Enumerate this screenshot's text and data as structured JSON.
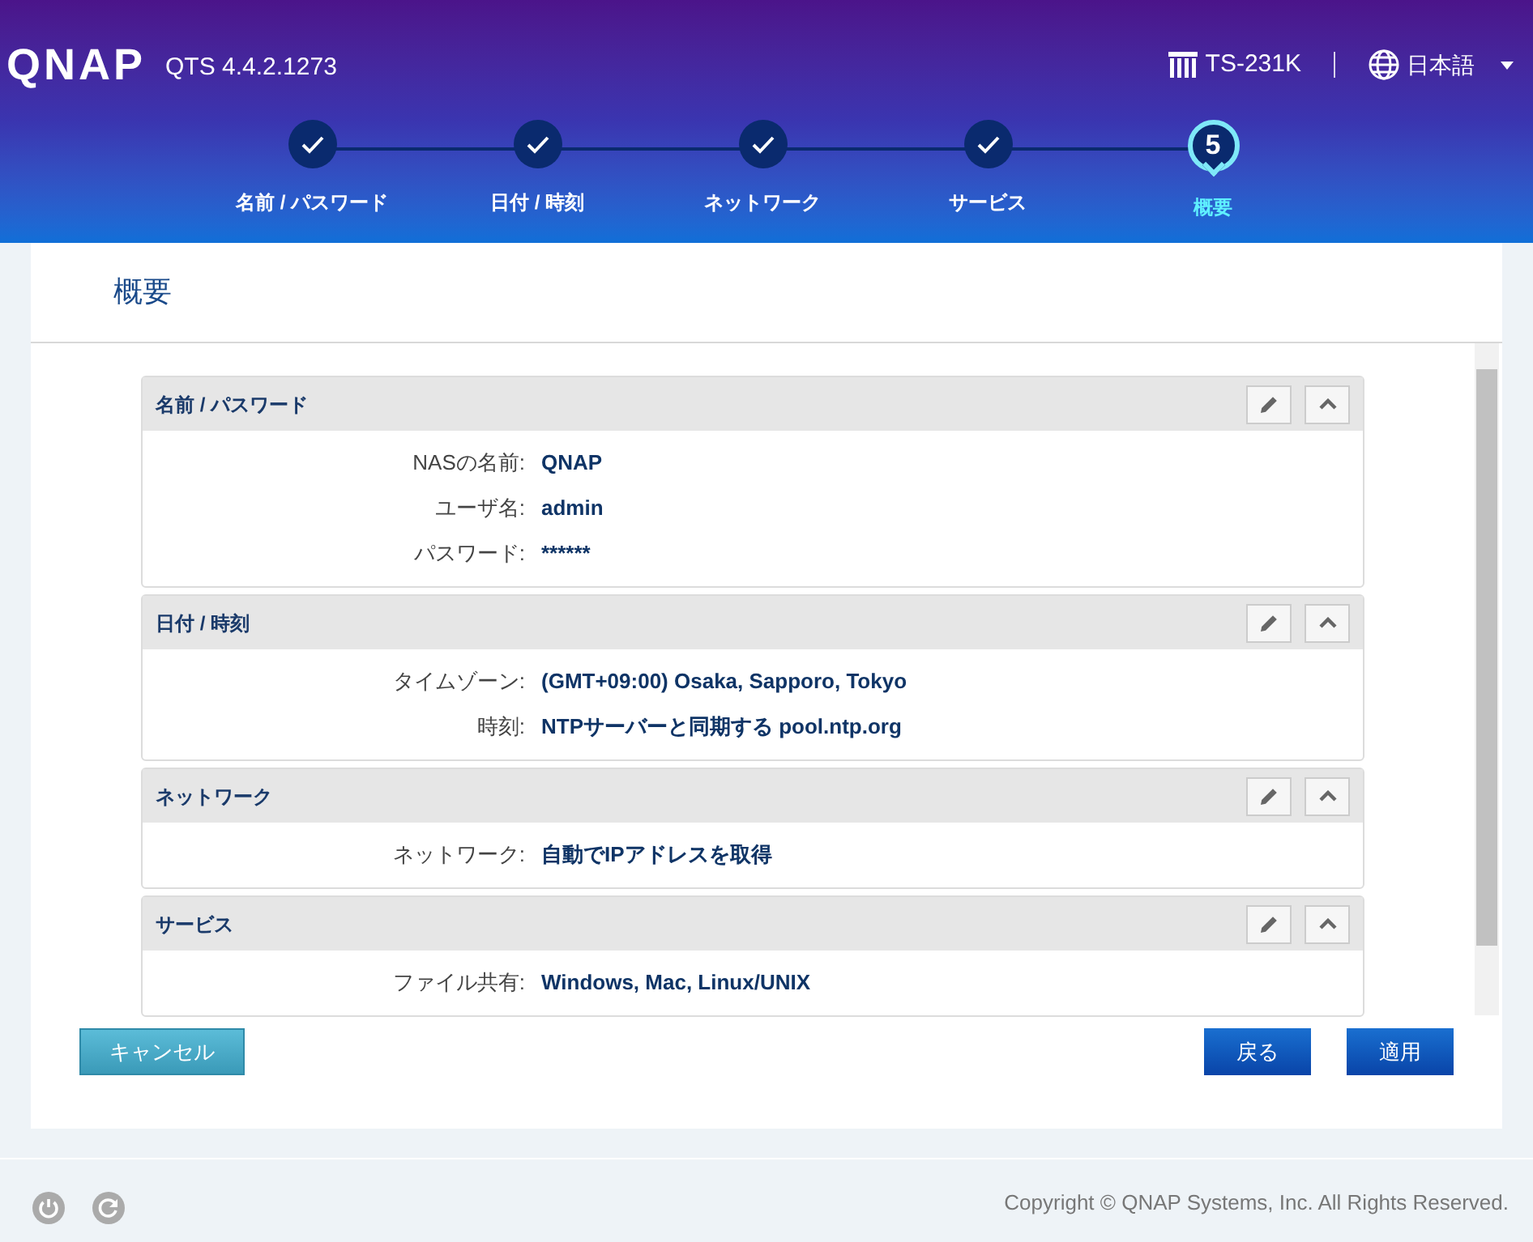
{
  "header": {
    "logo": "QNAP",
    "version": "QTS 4.4.2.1273",
    "device": "TS-231K",
    "language": "日本語"
  },
  "steps": [
    {
      "label": "名前 / パスワード",
      "completed": true,
      "selected": false
    },
    {
      "label": "日付 / 時刻",
      "completed": true,
      "selected": false
    },
    {
      "label": "ネットワーク",
      "completed": true,
      "selected": false
    },
    {
      "label": "サービス",
      "completed": true,
      "selected": false
    },
    {
      "label": "概要",
      "completed": false,
      "selected": true,
      "number": "5"
    }
  ],
  "panel": {
    "title": "概要",
    "sections": [
      {
        "title": "名前 / パスワード",
        "rows": [
          {
            "label": "NASの名前:",
            "value": "QNAP"
          },
          {
            "label": "ユーザ名:",
            "value": "admin"
          },
          {
            "label": "パスワード:",
            "value": "******"
          }
        ]
      },
      {
        "title": "日付 / 時刻",
        "rows": [
          {
            "label": "タイムゾーン:",
            "value": "(GMT+09:00) Osaka, Sapporo, Tokyo"
          },
          {
            "label": "時刻:",
            "value": "NTPサーバーと同期する pool.ntp.org"
          }
        ]
      },
      {
        "title": "ネットワーク",
        "rows": [
          {
            "label": "ネットワーク:",
            "value": "自動でIPアドレスを取得"
          }
        ]
      },
      {
        "title": "サービス",
        "rows": [
          {
            "label": "ファイル共有:",
            "value": "Windows, Mac, Linux/UNIX"
          }
        ]
      }
    ],
    "buttons": {
      "cancel": "キャンセル",
      "back": "戻る",
      "apply": "適用"
    }
  },
  "footer": {
    "copyright": "Copyright © QNAP Systems, Inc. All Rights Reserved."
  }
}
